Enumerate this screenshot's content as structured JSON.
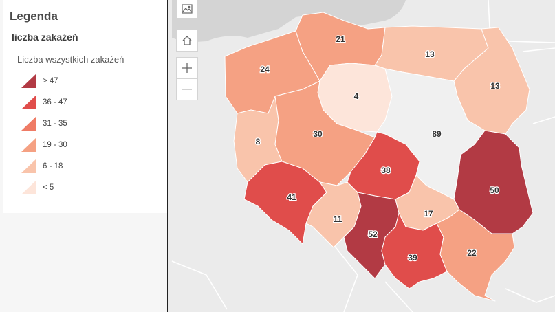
{
  "legend": {
    "title": "Legenda",
    "layer_name": "liczba zakażeń",
    "field_name": "Liczba wszystkich zakażeń",
    "classes": [
      {
        "label": "> 47",
        "color": "#b23a44"
      },
      {
        "label": "36 - 47",
        "color": "#e04d4b"
      },
      {
        "label": "31 - 35",
        "color": "#ef7b65"
      },
      {
        "label": "19 - 30",
        "color": "#f5a183"
      },
      {
        "label": "6 - 18",
        "color": "#f9c4ab"
      },
      {
        "label": "< 5",
        "color": "#fde5da"
      }
    ]
  },
  "map": {
    "regions": [
      {
        "id": "zachodniopomorskie",
        "value": "24",
        "color": "#f5a183"
      },
      {
        "id": "pomorskie",
        "value": "21",
        "color": "#f5a183"
      },
      {
        "id": "warminsko-mazurskie",
        "value": "13",
        "color": "#f9c4ab"
      },
      {
        "id": "podlaskie",
        "value": "13",
        "color": "#f9c4ab"
      },
      {
        "id": "kujawsko-pomorskie",
        "value": "4",
        "color": "#fde5da"
      },
      {
        "id": "lubuskie",
        "value": "8",
        "color": "#f9c4ab"
      },
      {
        "id": "wielkopolskie",
        "value": "30",
        "color": "#f5a183"
      },
      {
        "id": "mazowieckie",
        "value": "89",
        "color": "#f0f0f0"
      },
      {
        "id": "lodzkie",
        "value": "38",
        "color": "#e04d4b"
      },
      {
        "id": "lubelskie",
        "value": "50",
        "color": "#b23a44"
      },
      {
        "id": "dolnoslaskie",
        "value": "41",
        "color": "#e04d4b"
      },
      {
        "id": "opolskie",
        "value": "11",
        "color": "#f9c4ab"
      },
      {
        "id": "slaskie",
        "value": "52",
        "color": "#b23a44"
      },
      {
        "id": "swietokrzyskie",
        "value": "17",
        "color": "#f9c4ab"
      },
      {
        "id": "malopolskie",
        "value": "39",
        "color": "#e04d4b"
      },
      {
        "id": "podkarpackie",
        "value": "22",
        "color": "#f5a183"
      }
    ]
  },
  "controls": [
    "basemap-gallery-icon",
    "home-icon",
    "zoom-in-icon",
    "zoom-out-icon"
  ]
}
